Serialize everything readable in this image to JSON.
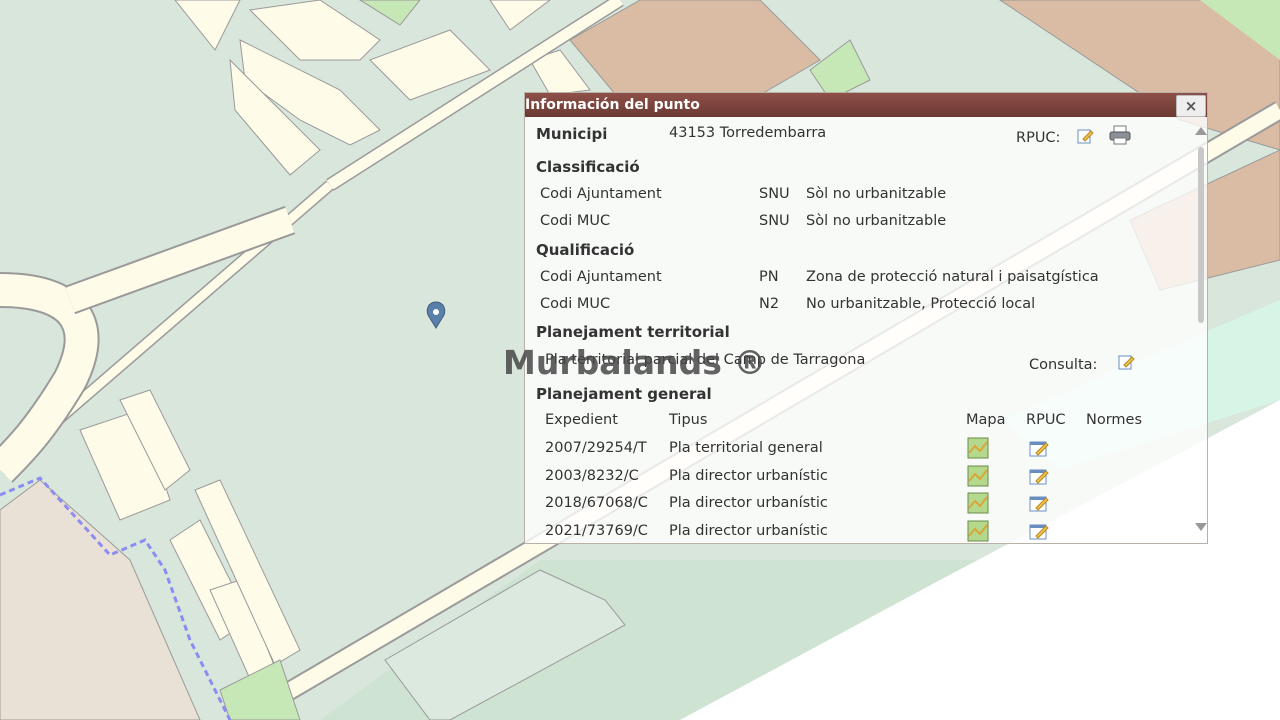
{
  "map": {
    "marker_icon": "map-pin-icon",
    "colors": {
      "background": "#d9e6dc",
      "road": "#fffbe9",
      "road_edge": "#9a9a9a",
      "urban": "#d9bca3",
      "green": "#c6e8b7",
      "boundary": "#8c8cf2"
    }
  },
  "popup": {
    "title": "Información del punto",
    "close_label": "×",
    "municipi": {
      "label": "Municipi",
      "value": "43153 Torredembarra",
      "rpuc_label": "RPUC:"
    },
    "classificacio": {
      "heading": "Classificació",
      "rows": [
        {
          "label": "Codi Ajuntament",
          "code": "SNU",
          "desc": "Sòl no urbanitzable"
        },
        {
          "label": "Codi MUC",
          "code": "SNU",
          "desc": "Sòl no urbanitzable"
        }
      ]
    },
    "qualificacio": {
      "heading": "Qualificació",
      "rows": [
        {
          "label": "Codi Ajuntament",
          "code": "PN",
          "desc": "Zona de protecció natural i paisatgística"
        },
        {
          "label": "Codi MUC",
          "code": "N2",
          "desc": "No urbanitzable, Protecció local"
        }
      ]
    },
    "planejament_territorial": {
      "heading": "Planejament territorial",
      "plan": "Pla territorial parcial del Camp de Tarragona",
      "consulta_label": "Consulta:"
    },
    "planejament_general": {
      "heading": "Planejament general",
      "columns": {
        "expedient": "Expedient",
        "tipus": "Tipus",
        "mapa": "Mapa",
        "rpuc": "RPUC",
        "normes": "Normes"
      },
      "rows": [
        {
          "expedient": "2007/29254/T",
          "tipus": "Pla territorial general"
        },
        {
          "expedient": "2003/8232/C",
          "tipus": "Pla director urbanístic"
        },
        {
          "expedient": "2018/67068/C",
          "tipus": "Pla director urbanístic"
        },
        {
          "expedient": "2021/73769/C",
          "tipus": "Pla director urbanístic"
        }
      ]
    }
  },
  "watermark": "Murbalands ®"
}
